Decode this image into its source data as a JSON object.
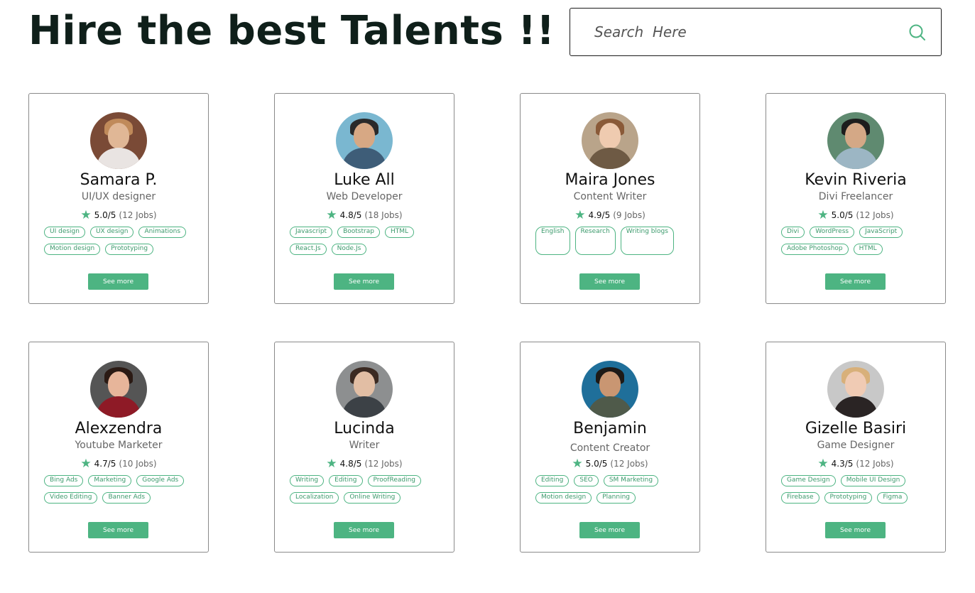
{
  "header": {
    "title": "Hire the best Talents !!"
  },
  "search": {
    "placeholder": "Search  Here",
    "icon": "search-icon"
  },
  "colors": {
    "accent": "#4db482",
    "title": "#0f1f1a",
    "border": "#8a8a8a"
  },
  "talents": [
    {
      "name": "Samara P.",
      "role": "UI/UX designer",
      "rating": "5.0/5",
      "jobs": "(12 Jobs)",
      "tags": [
        "UI design",
        "UX design",
        "Animations",
        "Motion design",
        "Prototyping"
      ],
      "button": "See more",
      "avatar": {
        "bg": "#7a4a36",
        "hair": "#c08a5a",
        "body": "#e9e4e2",
        "skin": "#e0b796"
      }
    },
    {
      "name": "Luke All",
      "role": "Web Developer",
      "rating": "4.8/5",
      "jobs": "(18 Jobs)",
      "tags": [
        "Javascript",
        "Bootstrap",
        "HTML",
        "React.Js",
        "Node.Js"
      ],
      "button": "See more",
      "avatar": {
        "bg": "#7ab7d0",
        "hair": "#2a2a2a",
        "body": "#3e5d78",
        "skin": "#d7a884"
      }
    },
    {
      "name": "Maira Jones",
      "role": "Content Writer",
      "rating": "4.9/5",
      "jobs": "(9 Jobs)",
      "tags": [
        "English",
        "Research",
        "Writing blogs"
      ],
      "button": "See more",
      "avatar": {
        "bg": "#b9a48a",
        "hair": "#8a5a38",
        "body": "#6e5a44",
        "skin": "#efcbb0"
      }
    },
    {
      "name": "Kevin Riveria",
      "role": "Divi Freelancer",
      "rating": "5.0/5",
      "jobs": "(12 Jobs)",
      "tags": [
        "Divi",
        "WordPress",
        "JavaScript",
        "Adobe Photoshop",
        "HTML"
      ],
      "button": "See more",
      "avatar": {
        "bg": "#5f8a70",
        "hair": "#1d1d1d",
        "body": "#9cb6c4",
        "skin": "#d4a886"
      }
    },
    {
      "name": "Alexzendra",
      "role": "Youtube Marketer",
      "rating": "4.7/5",
      "jobs": "(10 Jobs)",
      "tags": [
        "Bing Ads",
        "Marketing",
        "Google Ads",
        "Video Editing",
        "Banner Ads"
      ],
      "button": "See more",
      "avatar": {
        "bg": "#555555",
        "hair": "#2b1a14",
        "body": "#8e1a26",
        "skin": "#e7b59a"
      }
    },
    {
      "name": "Lucinda",
      "role": "Writer",
      "rating": "4.8/5",
      "jobs": "(12 Jobs)",
      "tags": [
        "Writing",
        "Editing",
        "ProofReading",
        "Localization",
        "Online Writing"
      ],
      "button": "See more",
      "avatar": {
        "bg": "#8d8f90",
        "hair": "#3b2a22",
        "body": "#3c4146",
        "skin": "#e2bea4"
      }
    },
    {
      "name": "Benjamin",
      "role": "Content Creator",
      "rating": "5.0/5",
      "jobs": "(12 Jobs)",
      "tags": [
        "Editing",
        "SEO",
        "SM Marketing",
        "Motion design",
        "Planning"
      ],
      "button": "See more",
      "avatar": {
        "bg": "#1f6f9a",
        "hair": "#1e1a17",
        "body": "#4f5a4a",
        "skin": "#c99672"
      }
    },
    {
      "name": "Gizelle Basiri",
      "role": "Game Designer",
      "rating": "4.3/5",
      "jobs": "(12 Jobs)",
      "tags": [
        "Game Design",
        "Mobile UI Design",
        "Firebase",
        "Prototyping",
        "Figma"
      ],
      "button": "See more",
      "avatar": {
        "bg": "#c8c8c8",
        "hair": "#d8b07a",
        "body": "#2a2424",
        "skin": "#f0cbb4"
      }
    }
  ]
}
